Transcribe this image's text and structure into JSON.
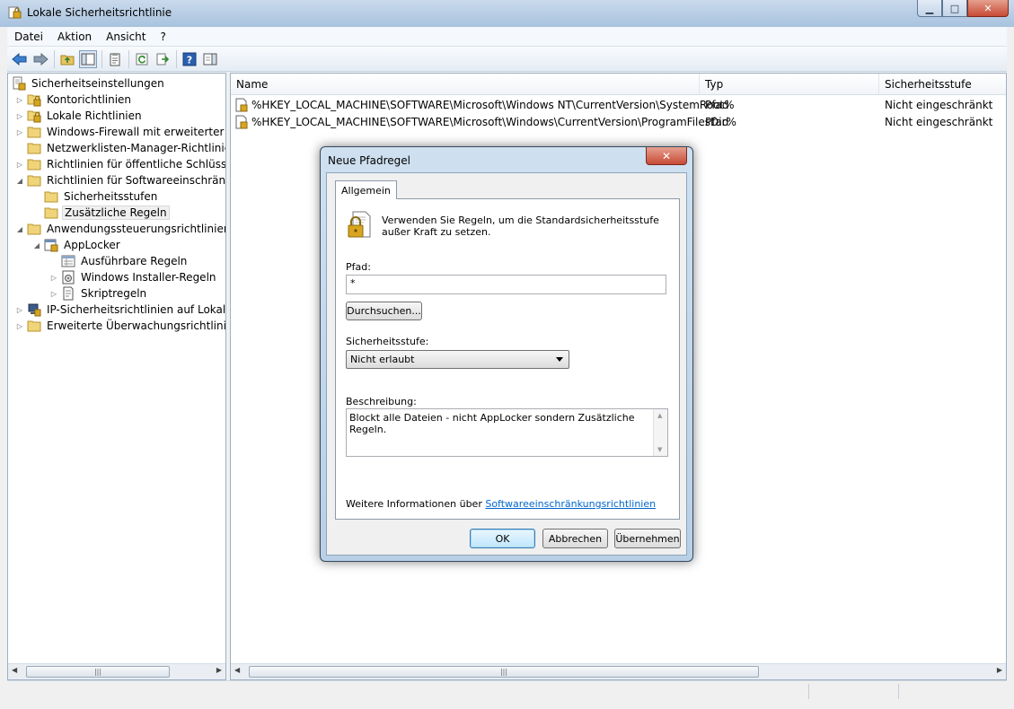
{
  "window": {
    "title": "Lokale Sicherheitsrichtlinie",
    "controls": {
      "minimize": "▁",
      "maximize": "□",
      "close": "✕"
    }
  },
  "menu": [
    "Datei",
    "Aktion",
    "Ansicht",
    "?"
  ],
  "toolbar": {
    "icons": [
      "back-icon",
      "forward-icon",
      "up-folder-icon",
      "show-hide-tree-icon",
      "properties-icon",
      "refresh-icon",
      "export-icon",
      "help-icon",
      "show-hide-action-pane-icon"
    ]
  },
  "tree": {
    "items": [
      {
        "label": "Sicherheitseinstellungen",
        "icon": "security-settings-icon",
        "level": 0,
        "expander": ""
      },
      {
        "label": "Kontorichtlinien",
        "icon": "folder-lock-icon",
        "level": 1,
        "expander": "▷"
      },
      {
        "label": "Lokale Richtlinien",
        "icon": "folder-lock-icon",
        "level": 1,
        "expander": "▷"
      },
      {
        "label": "Windows-Firewall mit erweiterter Sich",
        "icon": "folder-icon",
        "level": 1,
        "expander": "▷"
      },
      {
        "label": "Netzwerklisten-Manager-Richtlinien",
        "icon": "folder-icon",
        "level": 1,
        "expander": ""
      },
      {
        "label": "Richtlinien für öffentliche Schlüssel",
        "icon": "folder-icon",
        "level": 1,
        "expander": "▷"
      },
      {
        "label": "Richtlinien für Softwareeinschränkung",
        "icon": "folder-icon",
        "level": 1,
        "expander": "◢"
      },
      {
        "label": "Sicherheitsstufen",
        "icon": "folder-icon",
        "level": 2,
        "expander": ""
      },
      {
        "label": "Zusätzliche Regeln",
        "icon": "folder-icon",
        "level": 2,
        "expander": "",
        "selected": true
      },
      {
        "label": "Anwendungssteuerungsrichtlinien",
        "icon": "folder-icon",
        "level": 1,
        "expander": "◢"
      },
      {
        "label": "AppLocker",
        "icon": "applocker-icon",
        "level": 2,
        "expander": "◢"
      },
      {
        "label": "Ausführbare Regeln",
        "icon": "rules-icon",
        "level": 3,
        "expander": ""
      },
      {
        "label": "Windows Installer-Regeln",
        "icon": "installer-icon",
        "level": 3,
        "expander": "▷"
      },
      {
        "label": "Skriptregeln",
        "icon": "script-icon",
        "level": 3,
        "expander": "▷"
      },
      {
        "label": "IP-Sicherheitsrichtlinien auf Lokaler C",
        "icon": "ipsec-icon",
        "level": 1,
        "expander": "▷"
      },
      {
        "label": "Erweiterte Überwachungsrichtlinienkc",
        "icon": "folder-icon",
        "level": 1,
        "expander": "▷"
      }
    ]
  },
  "list": {
    "columns": {
      "name": "Name",
      "type": "Typ",
      "level": "Sicherheitsstufe"
    },
    "sort_indicator": "^",
    "rows": [
      {
        "name": "%HKEY_LOCAL_MACHINE\\SOFTWARE\\Microsoft\\Windows NT\\CurrentVersion\\SystemRoot%",
        "type": "Pfad",
        "level": "Nicht eingeschränkt"
      },
      {
        "name": "%HKEY_LOCAL_MACHINE\\SOFTWARE\\Microsoft\\Windows\\CurrentVersion\\ProgramFilesDir%",
        "type": "Pfad",
        "level": "Nicht eingeschränkt"
      }
    ]
  },
  "dialog": {
    "title": "Neue Pfadregel",
    "close": "✕",
    "tab": "Allgemein",
    "info": "Verwenden Sie Regeln, um die Standardsicherheitsstufe außer Kraft zu setzen.",
    "path_label": "Pfad:",
    "path_value": "*",
    "browse_label": "Durchsuchen...",
    "level_label": "Sicherheitsstufe:",
    "level_value": "Nicht erlaubt",
    "description_label": "Beschreibung:",
    "description_value": "Blockt alle Dateien - nicht AppLocker sondern Zusätzliche Regeln.",
    "more_info_prefix": "Weitere Informationen über ",
    "more_info_link": "Softwareeinschränkungsrichtlinien",
    "ok_label": "OK",
    "cancel_label": "Abbrechen",
    "apply_label": "Übernehmen"
  }
}
